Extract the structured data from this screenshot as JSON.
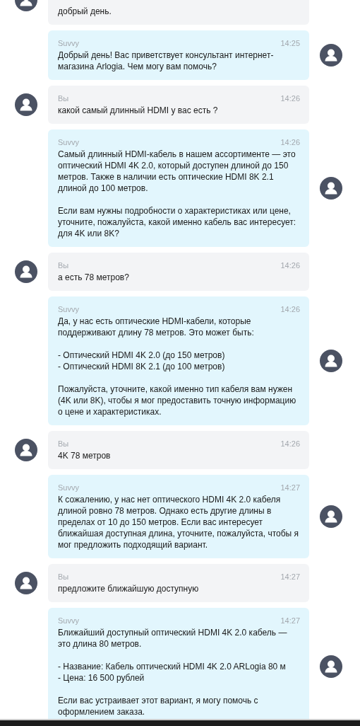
{
  "messages": [
    {
      "kind": "user",
      "text": "добрый день."
    },
    {
      "kind": "bot",
      "author": "Suvvy",
      "time": "14:25",
      "text": "Добрый день! Вас приветствует консультант интернет-магазина Arlogia. Чем могу вам помочь?"
    },
    {
      "kind": "user",
      "author": "Вы",
      "time": "14:26",
      "text": "какой самый длинный HDMI у вас есть ?"
    },
    {
      "kind": "bot",
      "author": "Suvvy",
      "time": "14:26",
      "text": "Самый длинный HDMI-кабель в нашем ассортименте — это оптический HDMI 4K 2.0, который доступен длиной до 150 метров. Также в наличии есть оптические HDMI 8K 2.1 длиной до 100 метров.\n\nЕсли вам нужны подробности о характеристиках или цене, уточните, пожалуйста, какой именно кабель вас интересует: для 4K или 8K?"
    },
    {
      "kind": "user",
      "author": "Вы",
      "time": "14:26",
      "text": "а есть 78 метров?"
    },
    {
      "kind": "bot",
      "author": "Suvvy",
      "time": "14:26",
      "text": "Да, у нас есть оптические HDMI-кабели, которые поддерживают длину 78 метров. Это может быть:\n\n- Оптический HDMI 4K 2.0 (до 150 метров)\n- Оптический HDMI 8K 2.1 (до 100 метров)\n\nПожалуйста, уточните, какой именно тип кабеля вам нужен (4K или 8K), чтобы я мог предоставить точную информацию о цене и характеристиках."
    },
    {
      "kind": "user",
      "author": "Вы",
      "time": "14:26",
      "text": "4K 78 метров"
    },
    {
      "kind": "bot",
      "author": "Suvvy",
      "time": "14:27",
      "text": "К сожалению, у нас нет оптического HDMI 4K 2.0 кабеля длиной ровно 78 метров. Однако есть другие длины в пределах от 10 до 150 метров. Если вас интересует ближайшая доступная длина, уточните, пожалуйста, чтобы я мог предложить подходящий вариант."
    },
    {
      "kind": "user",
      "author": "Вы",
      "time": "14:27",
      "text": "предложите ближайшую доступную"
    },
    {
      "kind": "bot",
      "author": "Suvvy",
      "time": "14:27",
      "text": "Ближайший доступный оптический HDMI 4K 2.0 кабель — это длина 80 метров.\n\n- Название: Кабель оптический HDMI 4K 2.0 ARLogia 80 м\n- Цена: 16 500 рублей\n\nЕсли вас устраивает этот вариант, я могу помочь с оформлением заказа."
    }
  ]
}
